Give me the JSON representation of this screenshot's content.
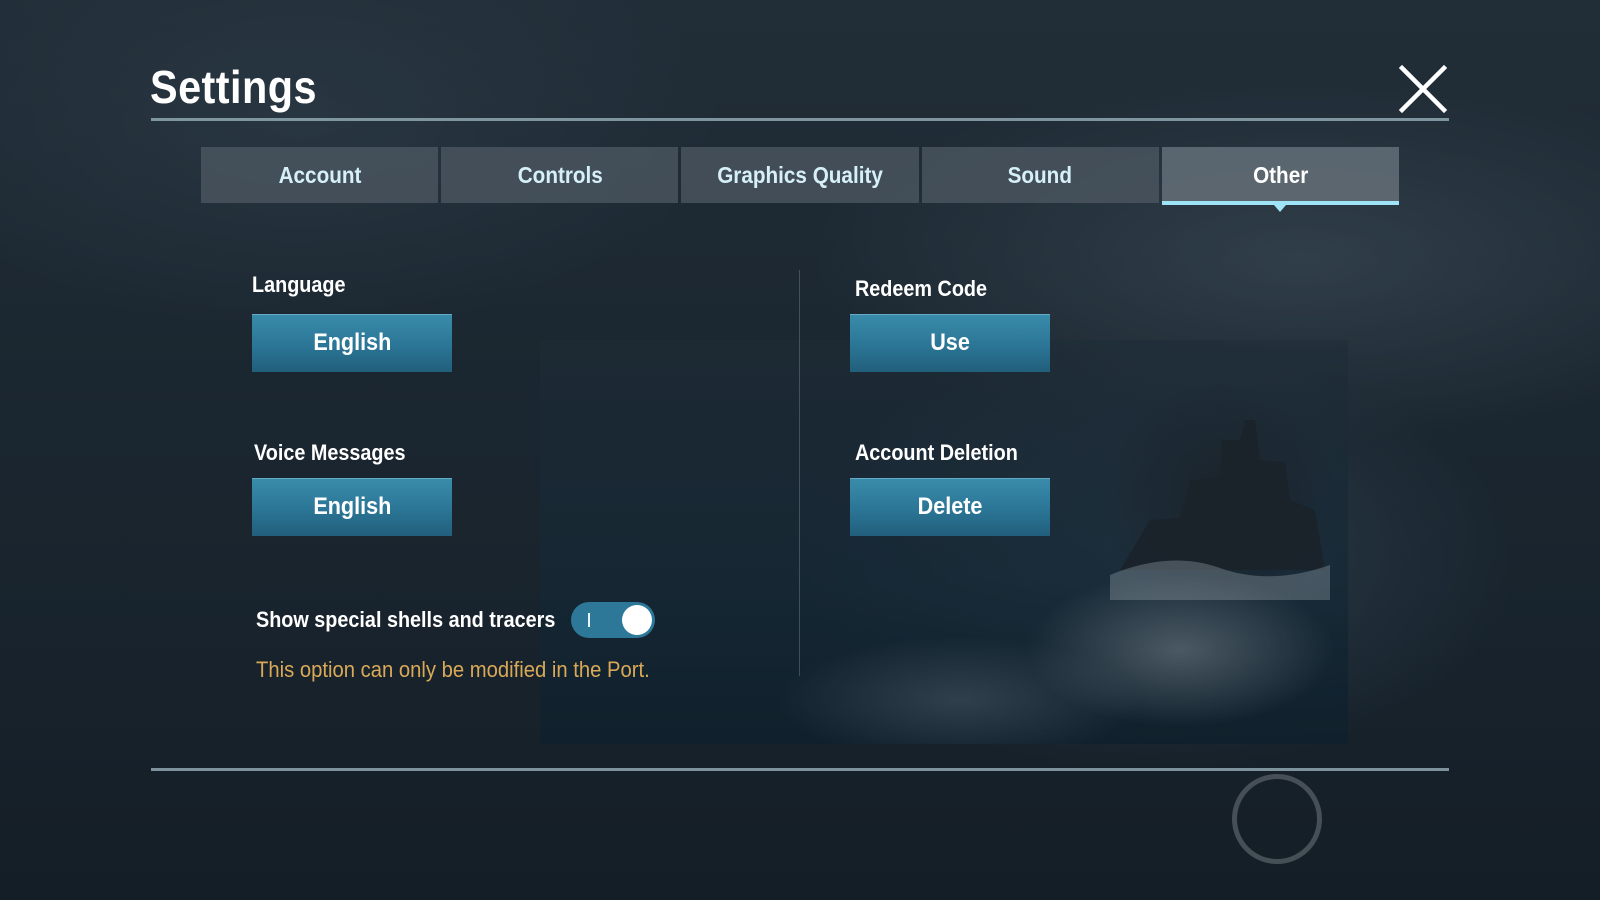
{
  "header": {
    "title": "Settings",
    "close_icon": "close-icon"
  },
  "tabs": [
    {
      "label": "Account",
      "active": false
    },
    {
      "label": "Controls",
      "active": false
    },
    {
      "label": "Graphics Quality",
      "active": false
    },
    {
      "label": "Sound",
      "active": false
    },
    {
      "label": "Other",
      "active": true
    }
  ],
  "left_panel": {
    "language": {
      "label": "Language",
      "value": "English"
    },
    "voice_messages": {
      "label": "Voice Messages",
      "value": "English"
    },
    "special_shells": {
      "label": "Show special shells and tracers",
      "enabled": true,
      "note": "This option can only be modified in the Port."
    }
  },
  "right_panel": {
    "redeem_code": {
      "label": "Redeem Code",
      "button": "Use"
    },
    "account_deletion": {
      "label": "Account Deletion",
      "button": "Delete"
    }
  },
  "colors": {
    "accent": "#9fe4f6",
    "button": "#2b7596",
    "note": "#d9a957",
    "title": "#ffffff"
  },
  "icons": {
    "close": "close-icon",
    "home_circle": "circle-button-icon"
  }
}
